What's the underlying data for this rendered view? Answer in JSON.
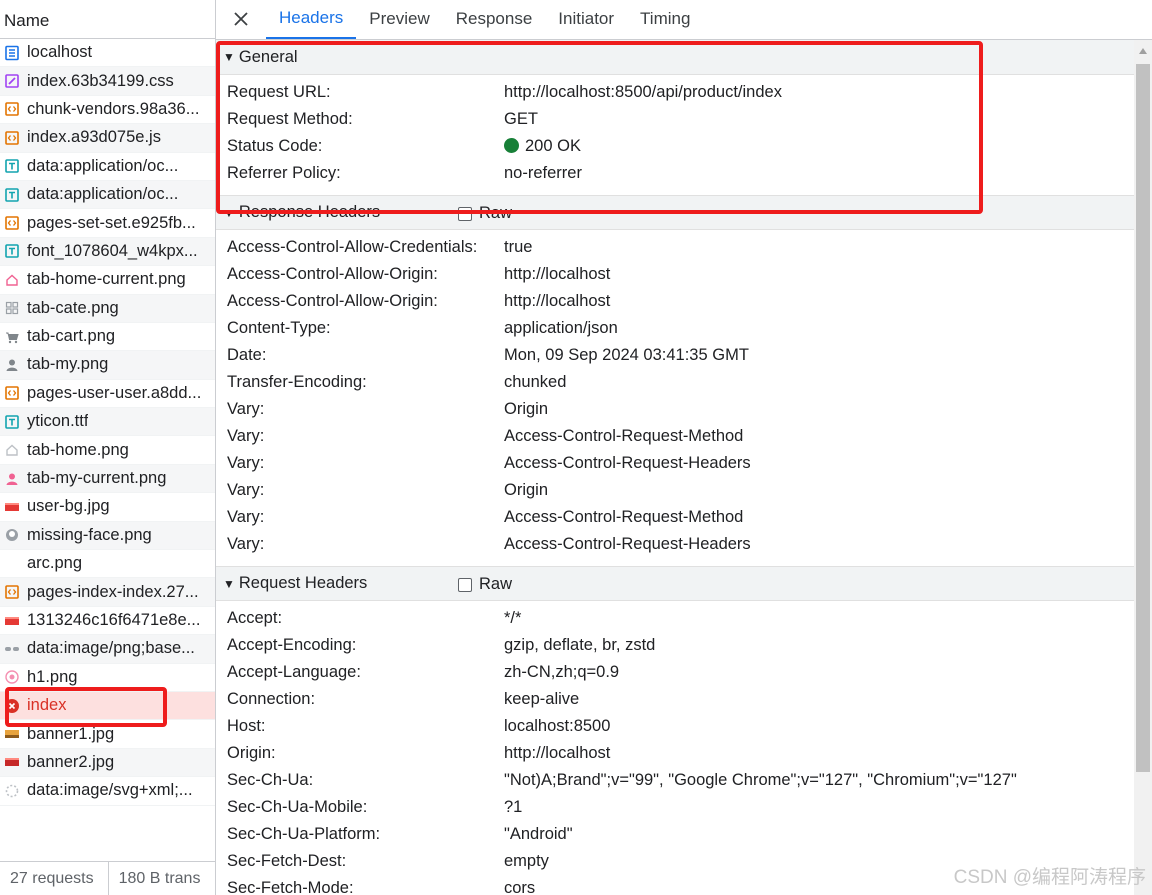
{
  "left_panel": {
    "name_header": "Name",
    "requests": [
      {
        "name": "localhost",
        "icon": "document-icon",
        "color": "#1a73e8"
      },
      {
        "name": "index.63b34199.css",
        "icon": "stylesheet-icon",
        "color": "#a142f4"
      },
      {
        "name": "chunk-vendors.98a36...",
        "icon": "script-icon",
        "color": "#e37400"
      },
      {
        "name": "index.a93d075e.js",
        "icon": "script-icon",
        "color": "#e37400"
      },
      {
        "name": "data:application/oc...",
        "icon": "font-icon",
        "color": "#12a4af"
      },
      {
        "name": "data:application/oc...",
        "icon": "font-icon",
        "color": "#12a4af"
      },
      {
        "name": "pages-set-set.e925fb...",
        "icon": "script-icon",
        "color": "#e37400"
      },
      {
        "name": "font_1078604_w4kpx...",
        "icon": "font-icon",
        "color": "#12a4af"
      },
      {
        "name": "tab-home-current.png",
        "icon": "home-image-icon",
        "color": "#f06292"
      },
      {
        "name": "tab-cate.png",
        "icon": "grid-image-icon",
        "color": "#9aa0a6"
      },
      {
        "name": "tab-cart.png",
        "icon": "cart-image-icon",
        "color": "#80868b"
      },
      {
        "name": "tab-my.png",
        "icon": "person-image-icon",
        "color": "#80868b"
      },
      {
        "name": "pages-user-user.a8dd...",
        "icon": "script-icon",
        "color": "#e37400"
      },
      {
        "name": "yticon.ttf",
        "icon": "font-icon",
        "color": "#12a4af"
      },
      {
        "name": "tab-home.png",
        "icon": "home-image-icon",
        "color": "#bdc1c6"
      },
      {
        "name": "tab-my-current.png",
        "icon": "person-image-icon",
        "color": "#f06292"
      },
      {
        "name": "user-bg.jpg",
        "icon": "red-image-icon",
        "color": "#e53935"
      },
      {
        "name": "missing-face.png",
        "icon": "face-image-icon",
        "color": "#9aa0a6"
      },
      {
        "name": "arc.png",
        "icon": "blank-image-icon",
        "color": "#ffffff"
      },
      {
        "name": "pages-index-index.27...",
        "icon": "script-icon",
        "color": "#e37400"
      },
      {
        "name": "1313246c16f6471e8e...",
        "icon": "red-image-icon",
        "color": "#e53935"
      },
      {
        "name": "data:image/png;base...",
        "icon": "dots-image-icon",
        "color": "#9aa0a6"
      },
      {
        "name": "h1.png",
        "icon": "circle-image-icon",
        "color": "#f48fb1"
      },
      {
        "name": "index",
        "icon": "error-icon",
        "color": "#d93025",
        "selected": true
      },
      {
        "name": "banner1.jpg",
        "icon": "banner-image-icon",
        "color": "#e8a33d"
      },
      {
        "name": "banner2.jpg",
        "icon": "red-image-icon",
        "color": "#c62828"
      },
      {
        "name": "data:image/svg+xml;...",
        "icon": "spinner-image-icon",
        "color": "#bdc1c6"
      }
    ],
    "footer": {
      "requests": "27 requests",
      "transferred": "180 B trans"
    }
  },
  "tabs": [
    "Headers",
    "Preview",
    "Response",
    "Initiator",
    "Timing"
  ],
  "active_tab": "Headers",
  "sections": {
    "general": {
      "title": "General",
      "rows": [
        {
          "key": "Request URL:",
          "value": "http://localhost:8500/api/product/index"
        },
        {
          "key": "Request Method:",
          "value": "GET"
        },
        {
          "key": "Status Code:",
          "value": "200 OK"
        },
        {
          "key": "Referrer Policy:",
          "value": "no-referrer"
        }
      ]
    },
    "response_headers": {
      "title": "Response Headers",
      "raw_label": "Raw",
      "rows": [
        {
          "key": "Access-Control-Allow-Credentials:",
          "value": "true"
        },
        {
          "key": "Access-Control-Allow-Origin:",
          "value": "http://localhost"
        },
        {
          "key": "Access-Control-Allow-Origin:",
          "value": "http://localhost"
        },
        {
          "key": "Content-Type:",
          "value": "application/json"
        },
        {
          "key": "Date:",
          "value": "Mon, 09 Sep 2024 03:41:35 GMT"
        },
        {
          "key": "Transfer-Encoding:",
          "value": "chunked"
        },
        {
          "key": "Vary:",
          "value": "Origin"
        },
        {
          "key": "Vary:",
          "value": "Access-Control-Request-Method"
        },
        {
          "key": "Vary:",
          "value": "Access-Control-Request-Headers"
        },
        {
          "key": "Vary:",
          "value": "Origin"
        },
        {
          "key": "Vary:",
          "value": "Access-Control-Request-Method"
        },
        {
          "key": "Vary:",
          "value": "Access-Control-Request-Headers"
        }
      ]
    },
    "request_headers": {
      "title": "Request Headers",
      "raw_label": "Raw",
      "rows": [
        {
          "key": "Accept:",
          "value": "*/*"
        },
        {
          "key": "Accept-Encoding:",
          "value": "gzip, deflate, br, zstd"
        },
        {
          "key": "Accept-Language:",
          "value": "zh-CN,zh;q=0.9"
        },
        {
          "key": "Connection:",
          "value": "keep-alive"
        },
        {
          "key": "Host:",
          "value": "localhost:8500"
        },
        {
          "key": "Origin:",
          "value": "http://localhost"
        },
        {
          "key": "Sec-Ch-Ua:",
          "value": "\"Not)A;Brand\";v=\"99\", \"Google Chrome\";v=\"127\", \"Chromium\";v=\"127\""
        },
        {
          "key": "Sec-Ch-Ua-Mobile:",
          "value": "?1"
        },
        {
          "key": "Sec-Ch-Ua-Platform:",
          "value": "\"Android\""
        },
        {
          "key": "Sec-Fetch-Dest:",
          "value": "empty"
        },
        {
          "key": "Sec-Fetch-Mode:",
          "value": "cors"
        }
      ]
    }
  },
  "status_dot_color": "#188038",
  "annotation_color": "#ee1c1c",
  "watermark": "CSDN @编程阿涛程序"
}
